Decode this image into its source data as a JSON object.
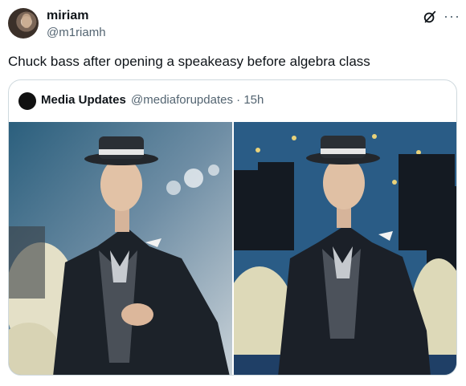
{
  "author": {
    "display_name": "miriam",
    "handle": "@m1riamh"
  },
  "tweet": {
    "text": "Chuck bass after opening a speakeasy before algebra class"
  },
  "quote": {
    "display_name": "Media Updates",
    "handle": "@mediaforupdates",
    "separator": "·",
    "time": "15h"
  },
  "icons": {
    "header_icon": "grok-icon",
    "menu_icon": "more-horizontal-icon"
  },
  "colors": {
    "text": "#0f1419",
    "secondary_text": "#536471",
    "border": "#cfd9de"
  }
}
